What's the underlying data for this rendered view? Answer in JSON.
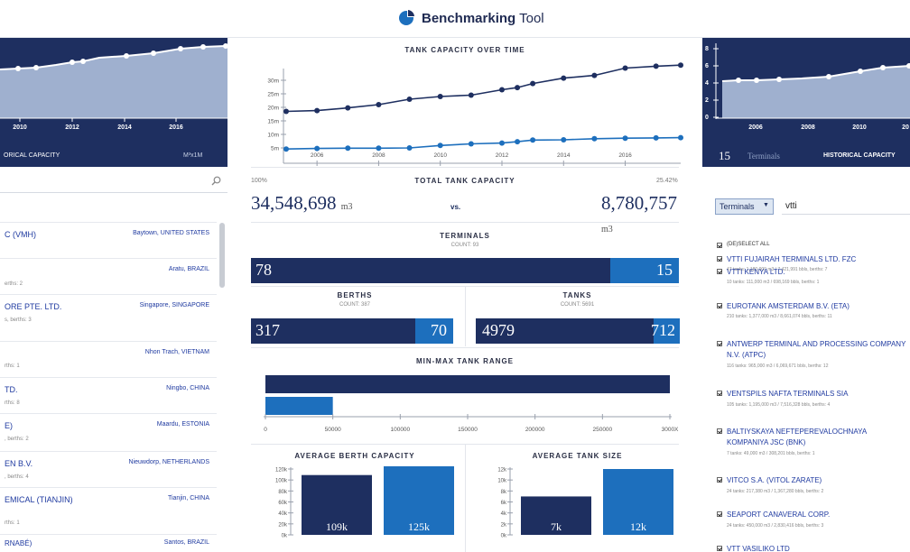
{
  "header": {
    "title_bold": "Benchmarking",
    "title_rest": "Tool"
  },
  "left_panel": {
    "chart": {
      "x_ticks": [
        "2010",
        "2012",
        "2014",
        "2016"
      ]
    },
    "footer_left": "ORICAL CAPACITY",
    "footer_right": "M³x1M",
    "search_value": "",
    "rows": [
      {
        "name": "C (VMH)",
        "location": "Baytown, UNITED STATES",
        "sub": ""
      },
      {
        "name": "",
        "location": "Aratu, BRAZIL",
        "sub": "erths: 2"
      },
      {
        "name": "ORE PTE. LTD.",
        "location": "Singapore, SINGAPORE",
        "sub": "s, berths: 3"
      },
      {
        "name": "",
        "location": "Nhon Trach, VIETNAM",
        "sub": "rths: 1"
      },
      {
        "name": "TD.",
        "location": "Ningbo, CHINA",
        "sub": "rths: 8"
      },
      {
        "name": "E)",
        "location": "Maardu, ESTONIA",
        "sub": ", berths: 2"
      },
      {
        "name": "EN B.V.",
        "location": "Nieuwdorp, NETHERLANDS",
        "sub": ", berths: 4"
      },
      {
        "name": "EMICAL (TIANJIN)",
        "location": "Tianjin, CHINA",
        "sub": "rths: 1"
      },
      {
        "name": "RNABÉ)",
        "location": "Santos, BRAZIL",
        "sub": ""
      }
    ]
  },
  "tank_capacity_chart": {
    "title": "TANK CAPACITY OVER TIME",
    "y_ticks": [
      "30m",
      "25m",
      "20m",
      "15m",
      "10m",
      "5m"
    ],
    "x_ticks": [
      "2006",
      "2008",
      "2010",
      "2012",
      "2014",
      "2016"
    ]
  },
  "chart_data": [
    {
      "type": "line",
      "title": "TANK CAPACITY OVER TIME",
      "x": [
        2005,
        2006,
        2007,
        2008,
        2009,
        2010,
        2011,
        2012,
        2012.5,
        2013,
        2014,
        2015,
        2016,
        2017,
        2017.8
      ],
      "ylim": [
        0,
        33
      ],
      "series": [
        {
          "values": [
            18.5,
            18.8,
            19.8,
            21.0,
            23.0,
            24.0,
            24.5,
            26.5,
            27.3,
            28.8,
            30.8,
            31.8,
            34.5,
            35.2,
            35.6
          ]
        },
        {
          "values": [
            4.6,
            4.8,
            4.9,
            4.9,
            5.0,
            5.9,
            6.5,
            6.8,
            7.3,
            7.9,
            8.0,
            8.4,
            8.6,
            8.7,
            8.8
          ]
        }
      ]
    },
    {
      "type": "bar",
      "title": "MIN-MAX TANK RANGE",
      "categories": [
        "max",
        "min"
      ],
      "values": [
        300000,
        50000
      ],
      "x_ticks": [
        "0",
        "50000",
        "100000",
        "150000",
        "200000",
        "250000",
        "3000X"
      ],
      "xlim": [
        0,
        300000
      ]
    },
    {
      "type": "bar",
      "title": "AVERAGE BERTH CAPACITY",
      "categories": [
        "a",
        "b"
      ],
      "values": [
        109000,
        125000
      ],
      "labels": [
        "109k",
        "125k"
      ],
      "y_ticks": [
        "120k",
        "100k",
        "80k",
        "60k",
        "40k",
        "20k",
        "0k"
      ],
      "ylim": [
        0,
        120000
      ]
    },
    {
      "type": "bar",
      "title": "AVERAGE TANK SIZE",
      "categories": [
        "a",
        "b"
      ],
      "values": [
        7000,
        12000
      ],
      "labels": [
        "7k",
        "12k"
      ],
      "y_ticks": [
        "12k",
        "10k",
        "8k",
        "6k",
        "4k",
        "2k",
        "0k"
      ],
      "ylim": [
        0,
        12000
      ]
    }
  ],
  "total_capacity": {
    "title": "TOTAL TANK CAPACITY",
    "left_pct": "100%",
    "right_pct": "25.42%",
    "left_value": "34,548,698",
    "right_value": "8,780,757",
    "unit": "m3",
    "vs": "vs."
  },
  "terminals": {
    "title": "TERMINALS",
    "count": "COUNT: 93",
    "left": "78",
    "right": "15",
    "fraction_right": 0.161
  },
  "berths": {
    "title": "BERTHS",
    "count": "COUNT: 387",
    "left": "317",
    "right": "70",
    "fraction_right": 0.181
  },
  "tanks": {
    "title": "TANKS",
    "count": "COUNT: 5691",
    "left": "4979",
    "right": "712",
    "fraction_right": 0.125
  },
  "right_panel": {
    "chart": {
      "x_ticks": [
        "2006",
        "2008",
        "2010",
        "20"
      ],
      "y_ticks": [
        "8",
        "6",
        "4",
        "2",
        "0"
      ]
    },
    "footer_count": "15",
    "footer_label": "Terminals",
    "footer_title": "HISTORICAL CAPACITY",
    "select_label": "Terminals",
    "search_value": "vtti",
    "deselect": "(DE)SELECT ALL",
    "items": [
      {
        "name": "VTTI FUJAIRAH TERMINALS LTD. FZC",
        "sub": "47 tanks: 1,180,000 m3 / 7,421,991 bbls, berths: 7"
      },
      {
        "name": "VTTI KENYA LTD.",
        "sub": "10 tanks: 111,000 m3 / 698,169 bbls, berths: 1"
      },
      {
        "name": "EUROTANK AMSTERDAM B.V. (ETA)",
        "sub": "210 tanks: 1,377,000 m3 / 8,661,074 bbls, berths: 11"
      },
      {
        "name": "ANTWERP TERMINAL AND PROCESSING COMPANY N.V. (ATPC)",
        "sub": "116 tanks: 965,000 m3 / 6,069,671 bbls, berths: 12"
      },
      {
        "name": "VENTSPILS NAFTA TERMINALS SIA",
        "sub": "105 tanks: 1,195,000 m3 / 7,516,328 bbls, berths: 4"
      },
      {
        "name": "BALTIYSKAYA NEFTEPEREVALOCHNAYA KOMPANIYA JSC (BNK)",
        "sub": "7 tanks: 49,000 m3 / 308,201 bbls, berths: 1"
      },
      {
        "name": "VITCO S.A. (VITOL ZARATE)",
        "sub": "24 tanks: 217,380 m3 / 1,367,280 bbls, berths: 2"
      },
      {
        "name": "SEAPORT CANAVERAL CORP.",
        "sub": "24 tanks: 450,000 m3 / 2,830,416 bbls, berths: 3"
      },
      {
        "name": "VTT VASILIKO LTD",
        "sub": ""
      }
    ]
  },
  "colors": {
    "navy": "#1e2f60",
    "blue": "#1d6fbd",
    "light_area": "#9fb0cf"
  }
}
